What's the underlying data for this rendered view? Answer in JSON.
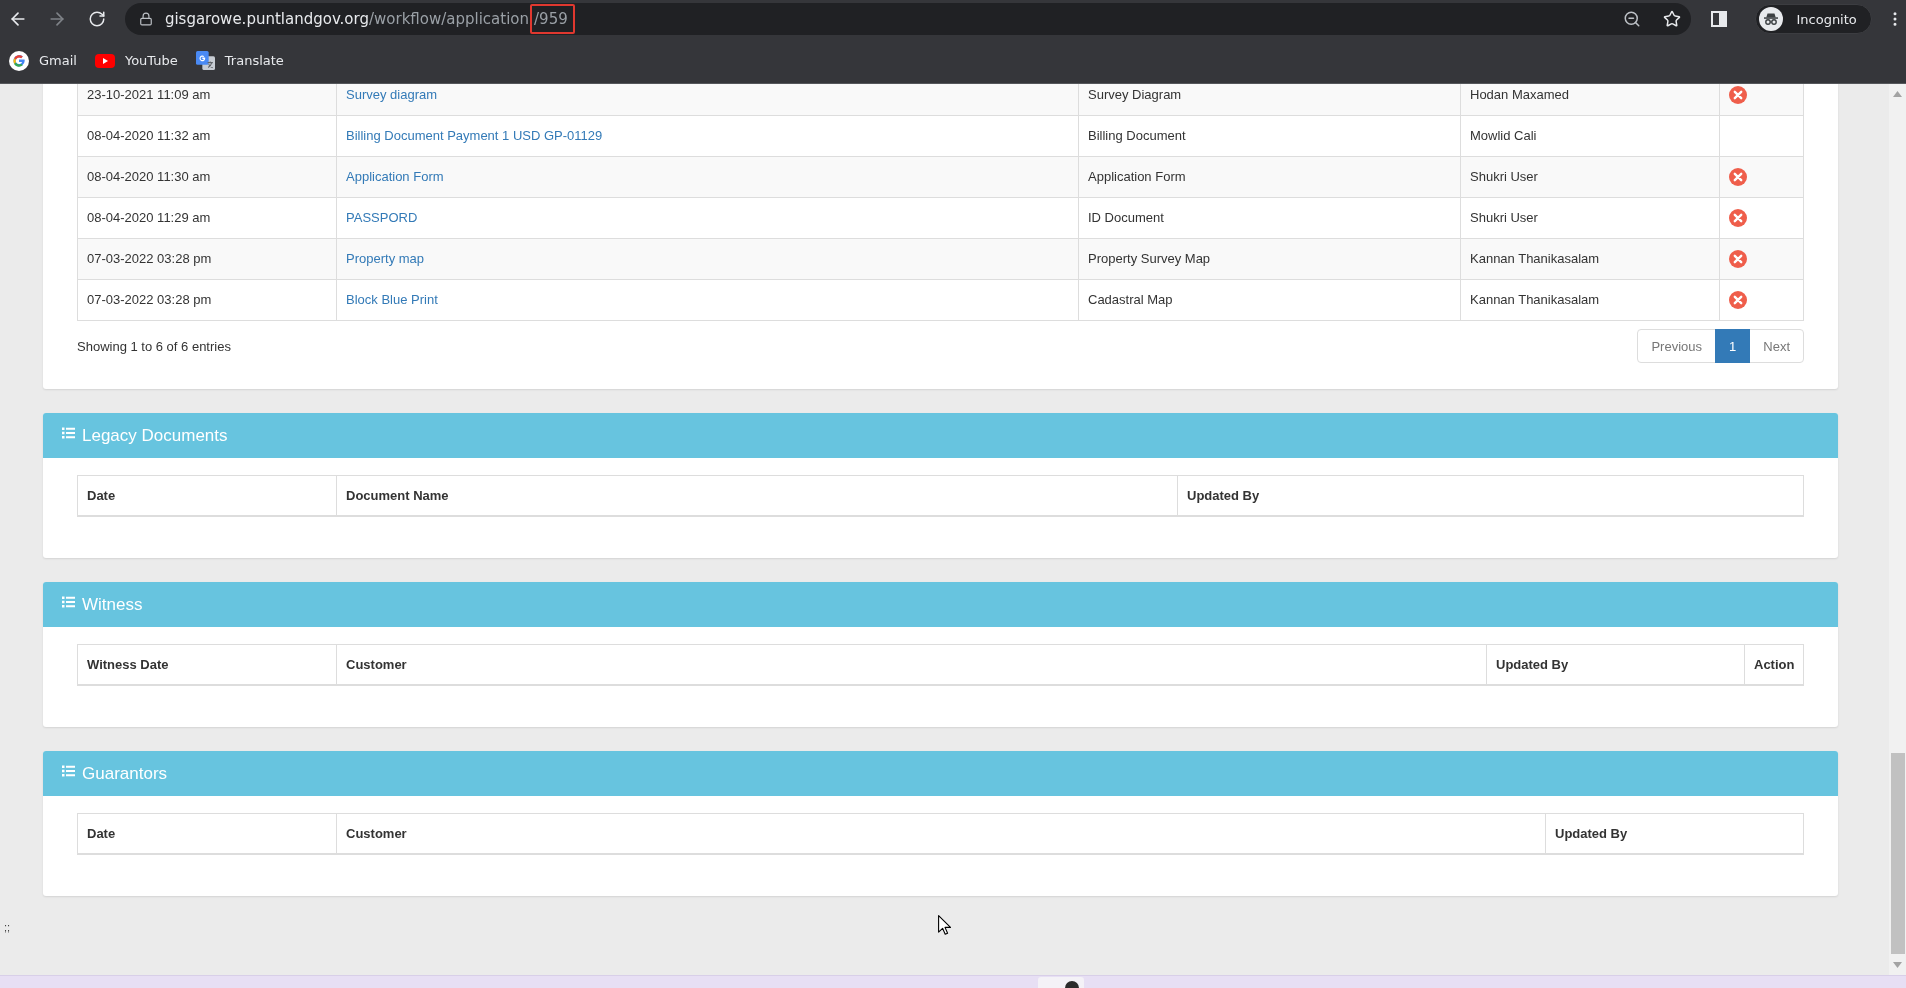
{
  "browser": {
    "url": {
      "host": "gisgarowe.puntlandgov.org",
      "path": "/workflow/application",
      "highlight": "/959"
    },
    "profile": "Incognito",
    "bookmarks": [
      {
        "kind": "google",
        "label": "Gmail"
      },
      {
        "kind": "youtube",
        "label": "YouTube"
      },
      {
        "kind": "translate",
        "label": "Translate"
      }
    ]
  },
  "documents": {
    "rows": [
      {
        "date": "23-10-2021 11:09 am",
        "name": "Survey diagram",
        "type": "Survey Diagram",
        "updated_by": "Hodan Maxamed",
        "deletable": true
      },
      {
        "date": "08-04-2020 11:32 am",
        "name": "Billing Document Payment 1 USD GP-01129",
        "type": "Billing Document",
        "updated_by": "Mowlid Cali",
        "deletable": false
      },
      {
        "date": "08-04-2020 11:30 am",
        "name": "Application Form",
        "type": "Application Form",
        "updated_by": "Shukri User",
        "deletable": true
      },
      {
        "date": "08-04-2020 11:29 am",
        "name": "PASSPORD",
        "type": "ID Document",
        "updated_by": "Shukri User",
        "deletable": true
      },
      {
        "date": "07-03-2022 03:28 pm",
        "name": "Property map",
        "type": "Property Survey Map",
        "updated_by": "Kannan Thanikasalam",
        "deletable": true
      },
      {
        "date": "07-03-2022 03:28 pm",
        "name": "Block Blue Print",
        "type": "Cadastral Map",
        "updated_by": "Kannan Thanikasalam",
        "deletable": true
      }
    ],
    "info": "Showing 1 to 6 of 6 entries",
    "pagination": [
      {
        "label": "Previous",
        "selected": false,
        "disabled": true
      },
      {
        "label": "1",
        "selected": true,
        "disabled": false
      },
      {
        "label": "Next",
        "selected": false,
        "disabled": true
      }
    ]
  },
  "panels": [
    {
      "title": "Legacy Documents",
      "columns": [
        "Date",
        "Document Name",
        "Updated By"
      ]
    },
    {
      "title": "Witness",
      "columns": [
        "Witness Date",
        "Customer",
        "Updated By",
        "Action"
      ]
    },
    {
      "title": "Guarantors",
      "columns": [
        "Date",
        "Customer",
        "Updated By"
      ]
    }
  ],
  "corner_text": ";;"
}
